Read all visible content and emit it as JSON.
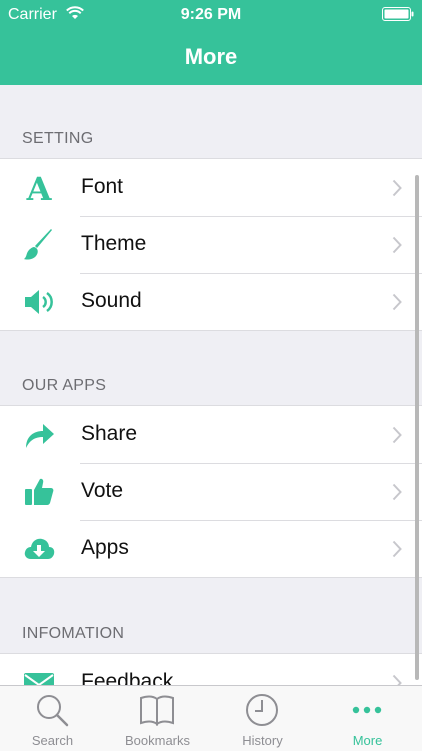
{
  "status_bar": {
    "carrier": "Carrier",
    "time": "9:26 PM"
  },
  "nav": {
    "title": "More"
  },
  "sections": [
    {
      "header": "SETTING",
      "items": [
        {
          "label": "Font",
          "icon": "font-icon"
        },
        {
          "label": "Theme",
          "icon": "brush-icon"
        },
        {
          "label": "Sound",
          "icon": "speaker-icon"
        }
      ]
    },
    {
      "header": "OUR APPS",
      "items": [
        {
          "label": "Share",
          "icon": "share-arrow-icon"
        },
        {
          "label": "Vote",
          "icon": "thumbs-up-icon"
        },
        {
          "label": "Apps",
          "icon": "cloud-download-icon"
        }
      ]
    },
    {
      "header": "INFOMATION",
      "items": [
        {
          "label": "Feedback",
          "icon": "envelope-icon"
        }
      ]
    }
  ],
  "tabs": [
    {
      "label": "Search",
      "icon": "search-icon"
    },
    {
      "label": "Bookmarks",
      "icon": "book-icon"
    },
    {
      "label": "History",
      "icon": "clock-icon"
    },
    {
      "label": "More",
      "icon": "more-dots-icon",
      "active": true
    }
  ],
  "colors": {
    "accent": "#36c29a",
    "header_bg": "#36c29a",
    "group_bg": "#efeff4"
  }
}
